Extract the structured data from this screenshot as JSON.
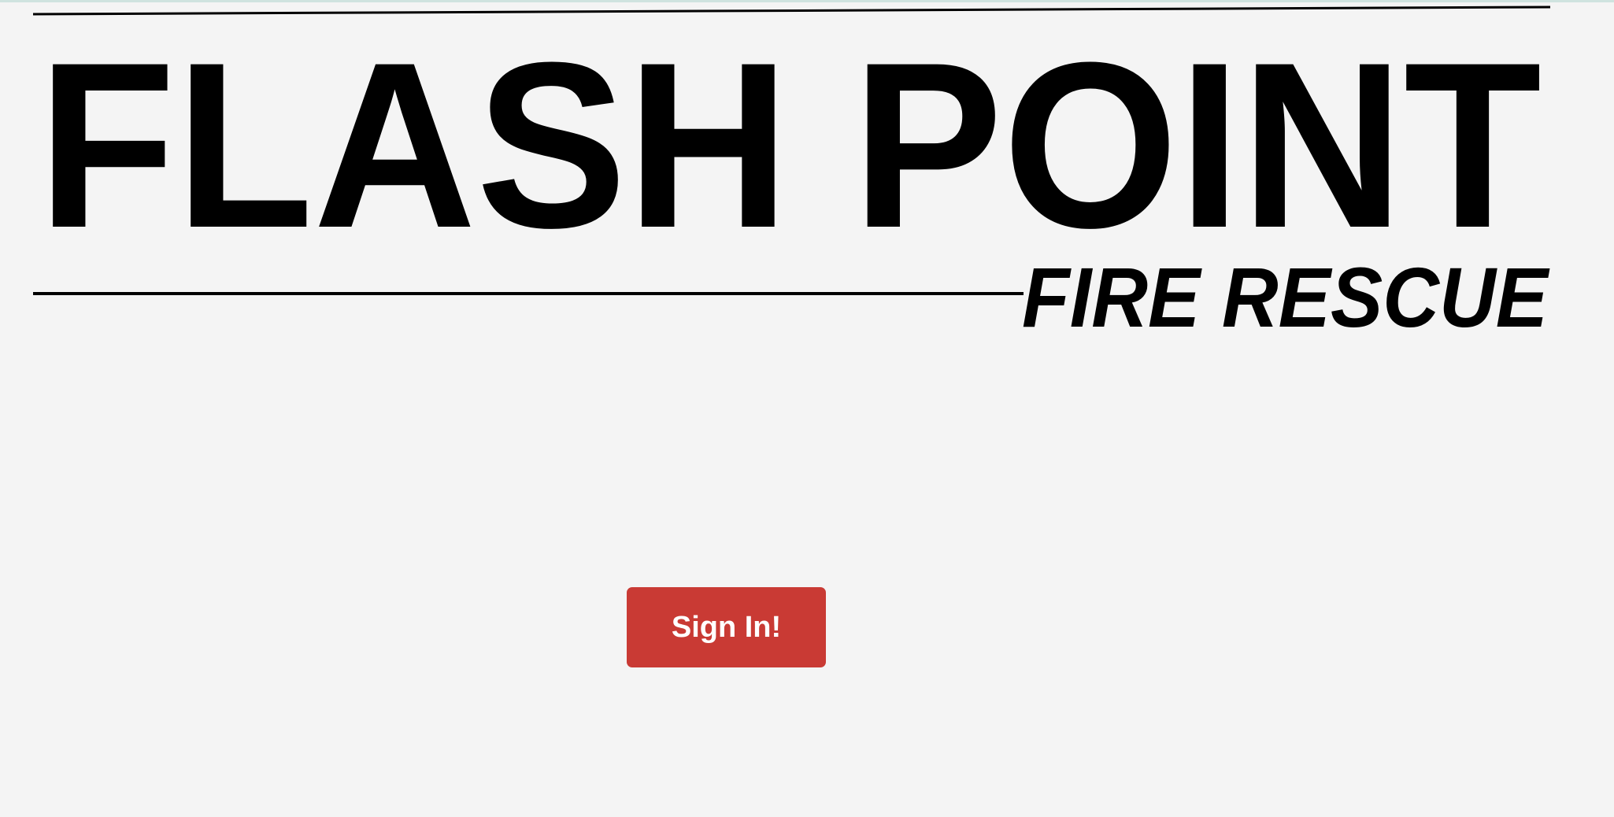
{
  "logo": {
    "title": "FLASH POINT",
    "subtitle": "FIRE RESCUE",
    "color": "#000000"
  },
  "actions": {
    "sign_in_label": "Sign In!",
    "sign_in_color": "#c93a34"
  }
}
